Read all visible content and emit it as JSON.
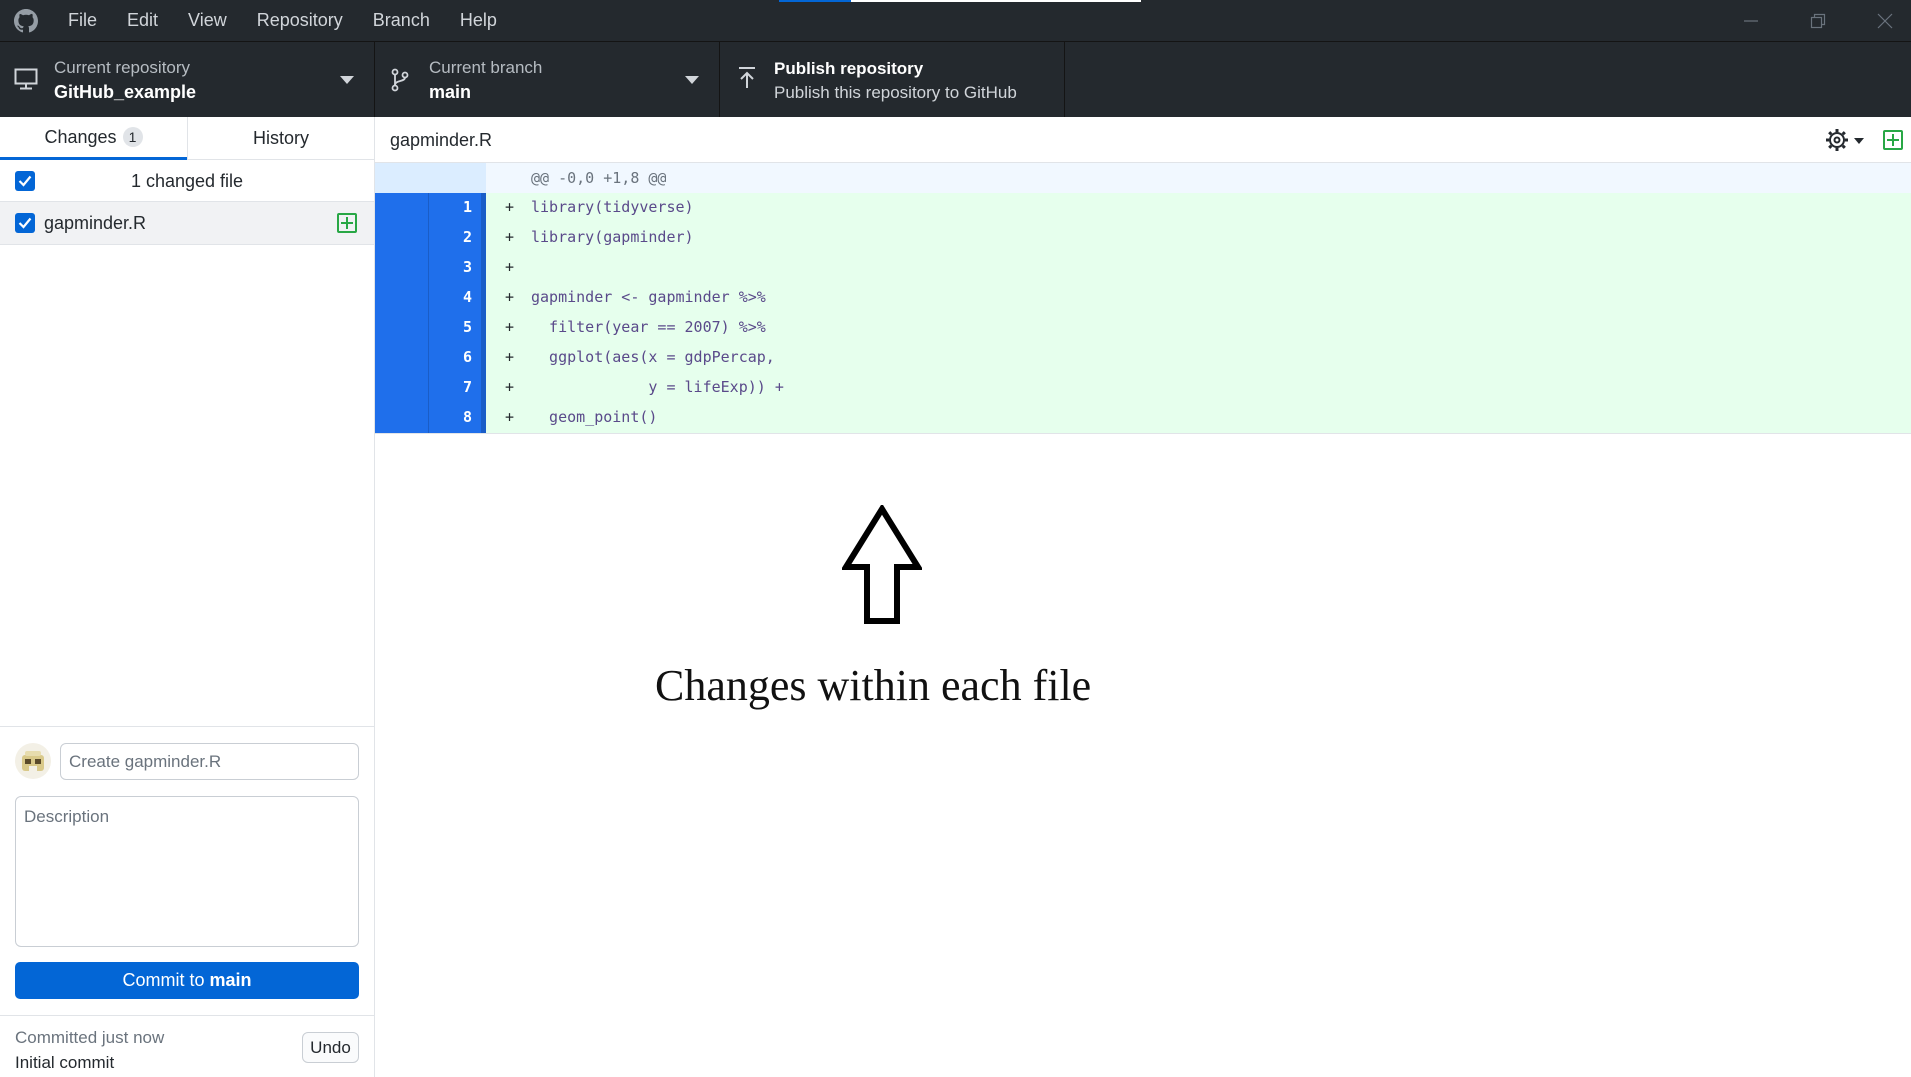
{
  "menu": [
    "File",
    "Edit",
    "View",
    "Repository",
    "Branch",
    "Help"
  ],
  "toolbar": {
    "repo_label": "Current repository",
    "repo_value": "GitHub_example",
    "branch_label": "Current branch",
    "branch_value": "main",
    "publish_title": "Publish repository",
    "publish_desc": "Publish this repository to GitHub"
  },
  "sidebar": {
    "tab_changes": "Changes",
    "tab_changes_count": "1",
    "tab_history": "History",
    "changed_summary": "1 changed file",
    "file_name": "gapminder.R"
  },
  "commit": {
    "summary_placeholder": "Create gapminder.R",
    "description_placeholder": "Description",
    "button_prefix": "Commit to",
    "button_branch": "main",
    "last_when": "Committed just now",
    "last_message": "Initial commit",
    "undo_label": "Undo"
  },
  "diff": {
    "file_path": "gapminder.R",
    "hunk_header": "@@ -0,0 +1,8 @@",
    "lines": [
      {
        "num": "1",
        "sign": "+",
        "code": "library(tidyverse)"
      },
      {
        "num": "2",
        "sign": "+",
        "code": "library(gapminder)"
      },
      {
        "num": "3",
        "sign": "+",
        "code": ""
      },
      {
        "num": "4",
        "sign": "+",
        "code": "gapminder <- gapminder %>%"
      },
      {
        "num": "5",
        "sign": "+",
        "code": "  filter(year == 2007) %>%"
      },
      {
        "num": "6",
        "sign": "+",
        "code": "  ggplot(aes(x = gdpPercap,"
      },
      {
        "num": "7",
        "sign": "+",
        "code": "             y = lifeExp)) +"
      },
      {
        "num": "8",
        "sign": "+",
        "code": "  geom_point()"
      }
    ]
  },
  "annotation": {
    "text": "Changes within each file"
  },
  "colors": {
    "accent": "#0366d6",
    "added_bg": "#e6ffed",
    "titlebar": "#24292e",
    "gutter": "#1f6feb"
  }
}
